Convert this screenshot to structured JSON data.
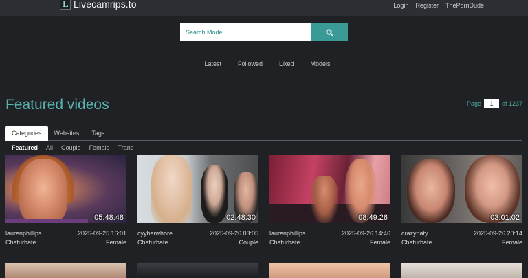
{
  "header": {
    "logo_letter": "L",
    "logo_text": "Livecamrips.to",
    "nav": [
      "Login",
      "Register",
      "ThePornDude"
    ]
  },
  "search": {
    "placeholder": "Search Model",
    "icon": "search-icon"
  },
  "main_nav": [
    "Latest",
    "Followed",
    "Liked",
    "Models"
  ],
  "page": {
    "title": "Featured videos",
    "pager_label": "Page",
    "pager_value": "1",
    "pager_total": "of 1237"
  },
  "tabs": [
    "Categories",
    "Websites",
    "Tags"
  ],
  "active_tab": "Categories",
  "subtabs": [
    "Featured",
    "All",
    "Couple",
    "Female",
    "Trans"
  ],
  "active_subtab": "Featured",
  "videos": [
    {
      "duration": "05:48:48",
      "model": "laurenphillips",
      "date": "2025-09-25 16:01",
      "site": "Chaturbate",
      "category": "Female"
    },
    {
      "duration": "02:48:30",
      "model": "cyyberwhore",
      "date": "2025-09-26 03:05",
      "site": "Chaturbate",
      "category": "Couple"
    },
    {
      "duration": "08:49:26",
      "model": "laurenphillips",
      "date": "2025-09-26 14:46",
      "site": "Chaturbate",
      "category": "Female"
    },
    {
      "duration": "03:01:02",
      "model": "crazypaty",
      "date": "2025-09-26 20:14",
      "site": "Chaturbate",
      "category": "Female"
    }
  ],
  "colors": {
    "accent": "#3a9a95",
    "heading": "#58b4ae",
    "background": "#202125",
    "topbar": "#2b2f33"
  }
}
